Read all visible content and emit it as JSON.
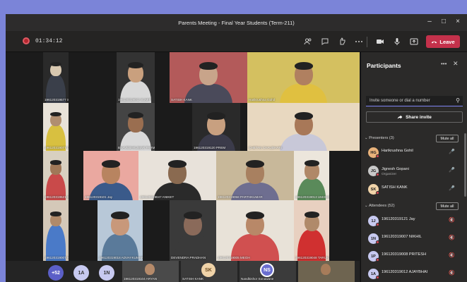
{
  "window": {
    "title": "Parents Meeting - Final Year Students (Term-211)",
    "controls": [
      "–",
      "□",
      "×"
    ]
  },
  "toolbar": {
    "timer": "01:34:12",
    "leave_label": "Leave",
    "buttons": [
      "participants-icon",
      "chat-icon",
      "reactions-icon",
      "more-icon",
      "camera-icon",
      "mic-icon",
      "share-icon"
    ]
  },
  "tiles": [
    {
      "label": "196120319577 SHUBHAM"
    },
    {
      "label": "196120319042 SUMIT"
    },
    {
      "label": "SATISH KANK"
    },
    {
      "label": "Harikrushna Gohil"
    },
    {
      "label": "196120319077 DHANRAJKUMAR"
    },
    {
      "label": "BHAVESHKUMAR PARMAR"
    },
    {
      "label": "196120319120 PREM"
    },
    {
      "label": "CHETAN CHAUDHARI"
    },
    {
      "label": "196120319521 SUDHANSHU"
    },
    {
      "label": "196120319101 Jay"
    },
    {
      "label": "196120319047 ANIKET"
    },
    {
      "label": "196120319058 PARTHKUMAR"
    },
    {
      "label": "196120319013 UMANGKUMAR"
    },
    {
      "label": "196120319007 NIKHIL"
    },
    {
      "label": "196120319018 ADVAYKUMAR"
    },
    {
      "label": "DEVENDRA PRADHAN"
    },
    {
      "label": "196120319005 MEGH"
    },
    {
      "label": "196120319048 TARUN"
    }
  ],
  "bottom_bar": {
    "overflow_count": "+52",
    "avatars": [
      "1A",
      "1N"
    ],
    "thumbs": [
      {
        "label": "196120319104 ARYAN"
      },
      {
        "initials": "SK",
        "label": "SATISH KANK"
      },
      {
        "initials": "NS",
        "label": "Nandkishor Sonawane"
      }
    ]
  },
  "participants": {
    "title": "Participants",
    "invite_placeholder": "Invite someone or dial a number",
    "share_invite": "Share invite",
    "presenters_header": "Presenters (3)",
    "attendees_header": "Attendees (52)",
    "mute_all": "Mute all",
    "presenters": [
      {
        "name": "Harikrushna Gohil",
        "role": "",
        "initials": "HG"
      },
      {
        "name": "Jignesh Gopani",
        "role": "Organizer",
        "initials": "JG"
      },
      {
        "name": "SATISH KANK",
        "role": "",
        "initials": "SK"
      }
    ],
    "attendees": [
      {
        "name": "196120319121 Jay",
        "initials": "1J"
      },
      {
        "name": "196120319007 NIKHIL",
        "initials": "1N"
      },
      {
        "name": "196120319008 PRITESH",
        "initials": "1P"
      },
      {
        "name": "196120319012 AJAYBHAI",
        "initials": "1A"
      }
    ]
  },
  "colors": {
    "accent": "#7f85f5",
    "leave": "#c4314b",
    "panel": "#2b2a29",
    "stage": "#1b1b1b"
  }
}
